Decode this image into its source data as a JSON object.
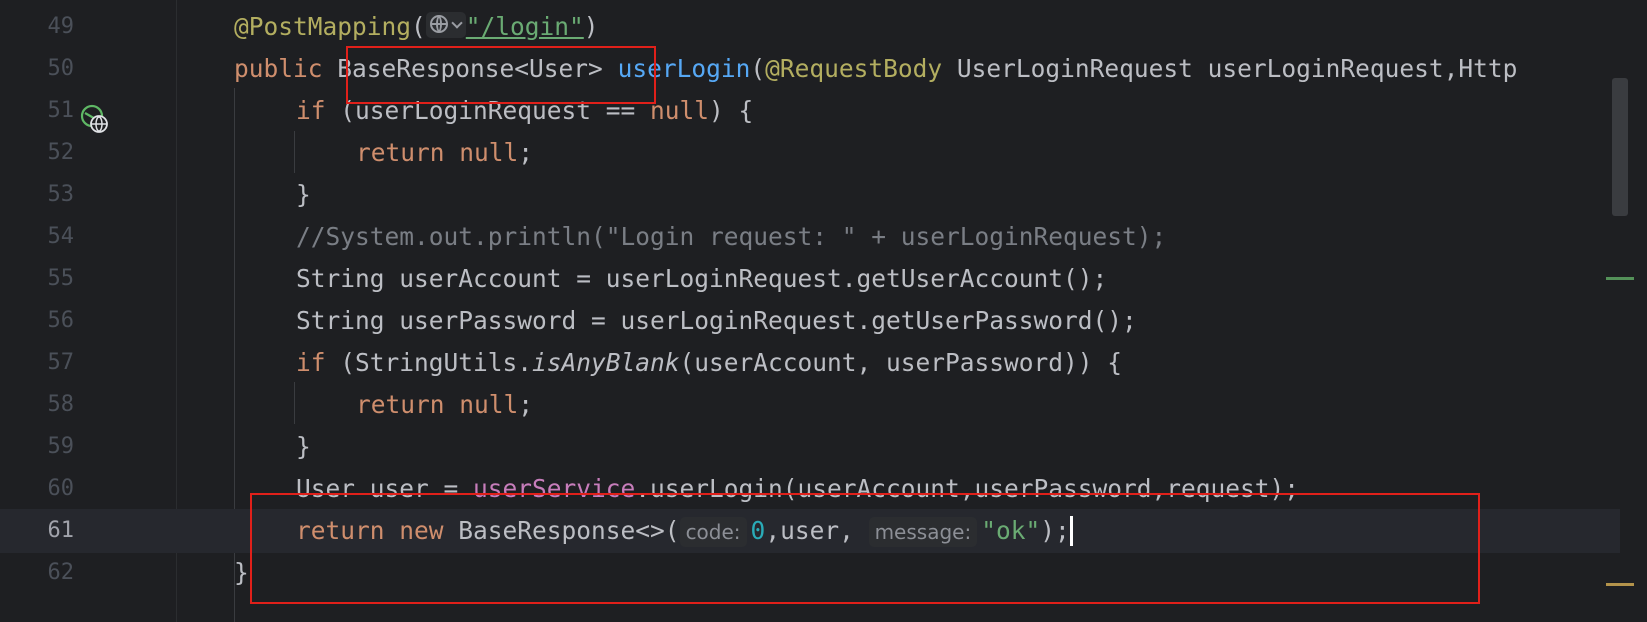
{
  "editor": {
    "lines": [
      {
        "num": "49",
        "annotation": "@PostMapping",
        "open_paren": "(",
        "path": "\"/login\"",
        "close_paren": ")"
      },
      {
        "num": "50",
        "kw": "public",
        "return_type": "BaseResponse<User>",
        "method_name": "userLogin",
        "rest": "(@RequestBody UserLoginRequest userLoginRequest,Http",
        "annotation2": "@RequestBody"
      },
      {
        "num": "51",
        "kw": "if",
        "rest1": " (userLoginRequest == ",
        "null_kw": "null",
        "rest2": ") {"
      },
      {
        "num": "52",
        "kw": "return",
        "null_kw": "null",
        "end": ";"
      },
      {
        "num": "53",
        "text": "}"
      },
      {
        "num": "54",
        "comment": "//System.out.println(\"Login request: \" + userLoginRequest);"
      },
      {
        "num": "55",
        "text": "String userAccount = userLoginRequest.getUserAccount();"
      },
      {
        "num": "56",
        "text": "String userPassword = userLoginRequest.getUserPassword();"
      },
      {
        "num": "57",
        "kw": "if",
        "rest1": " (StringUtils.",
        "italic": "isAnyBlank",
        "rest2": "(userAccount, userPassword)) {"
      },
      {
        "num": "58",
        "kw": "return",
        "null_kw": "null",
        "end": ";"
      },
      {
        "num": "59",
        "text": "}"
      },
      {
        "num": "60",
        "part1": "User user = ",
        "field": "userService",
        "part2": ".userLogin(userAccount,userPassword,request);"
      },
      {
        "num": "61",
        "kw1": "return",
        "kw2": "new",
        "part1": " BaseResponse<>(",
        "hint1": "code:",
        "num_val": "0",
        "part2": ",user, ",
        "hint2": "message:",
        "str": "\"ok\"",
        "part3": ");"
      },
      {
        "num": "62",
        "text": "}"
      }
    ]
  },
  "colors": {
    "background": "#1e1f22",
    "highlight_box": "#e0201a",
    "keyword": "#cf8e6d",
    "annotation": "#b3ae60",
    "string": "#6aab73",
    "method": "#56a8f5",
    "field": "#c77dbb"
  },
  "icons": {
    "gutter": "endpoint-globe-icon",
    "inlay": "globe-icon"
  }
}
